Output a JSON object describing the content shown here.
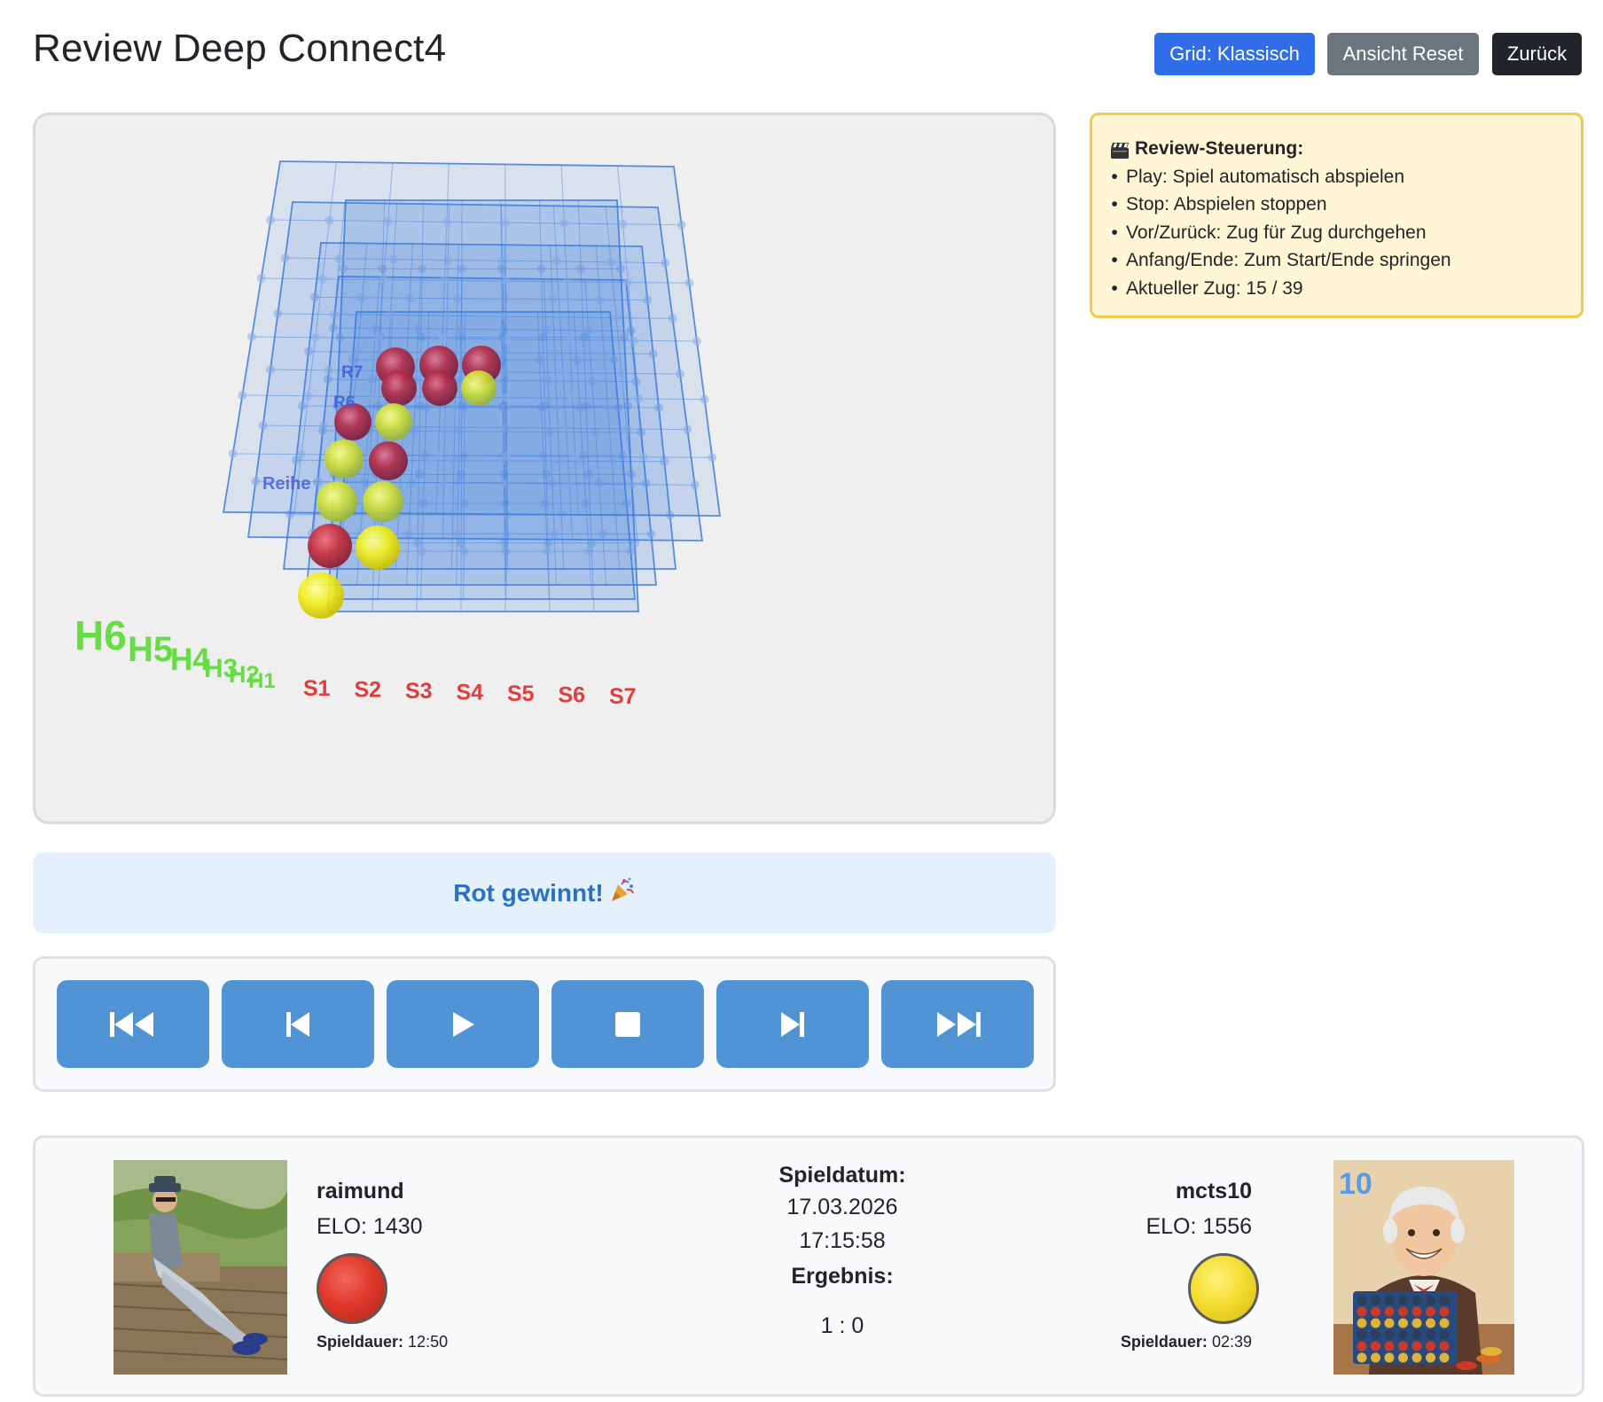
{
  "header": {
    "title": "Review Deep Connect4",
    "buttons": {
      "grid": "Grid: Klassisch",
      "reset": "Ansicht Reset",
      "back": "Zurück"
    }
  },
  "board3d": {
    "row_label": "Reihe",
    "row_labels": [
      "R7",
      "R6"
    ],
    "height_labels": [
      "H6",
      "H5",
      "H4",
      "H3",
      "H2",
      "H1"
    ],
    "column_labels": [
      "S1",
      "S2",
      "S3",
      "S4",
      "S5",
      "S6",
      "S7"
    ],
    "colors": {
      "grid": "#3d7ddb",
      "red": "#c8303a",
      "yellow": "#e7ea2c",
      "height_label": "#66dd44",
      "column_label": "#e23c3c"
    }
  },
  "info": {
    "icon": "clapperboard-icon",
    "heading": "Review-Steuerung:",
    "items": [
      "Play: Spiel automatisch abspielen",
      "Stop: Abspielen stoppen",
      "Vor/Zurück: Zug für Zug durchgehen",
      "Anfang/Ende: Zum Start/Ende springen",
      "Aktueller Zug: 15 / 39"
    ]
  },
  "result_banner": {
    "text": "Rot gewinnt!",
    "icon": "party-popper-icon"
  },
  "controls": [
    {
      "icon": "skip-to-start-icon"
    },
    {
      "icon": "step-back-icon"
    },
    {
      "icon": "play-icon"
    },
    {
      "icon": "stop-icon"
    },
    {
      "icon": "step-forward-icon"
    },
    {
      "icon": "skip-to-end-icon"
    }
  ],
  "players": {
    "left": {
      "name": "raimund",
      "elo": "ELO: 1430",
      "duration_label": "Spieldauer:",
      "duration": "12:50",
      "color": "red"
    },
    "right": {
      "name": "mcts10",
      "elo": "ELO: 1556",
      "duration_label": "Spieldauer:",
      "duration": "02:39",
      "color": "yellow",
      "avatar_badge": "10"
    }
  },
  "game": {
    "date_label": "Spieldatum:",
    "date": "17.03.2026",
    "time": "17:15:58",
    "result_label": "Ergebnis:",
    "result": "1 : 0"
  }
}
